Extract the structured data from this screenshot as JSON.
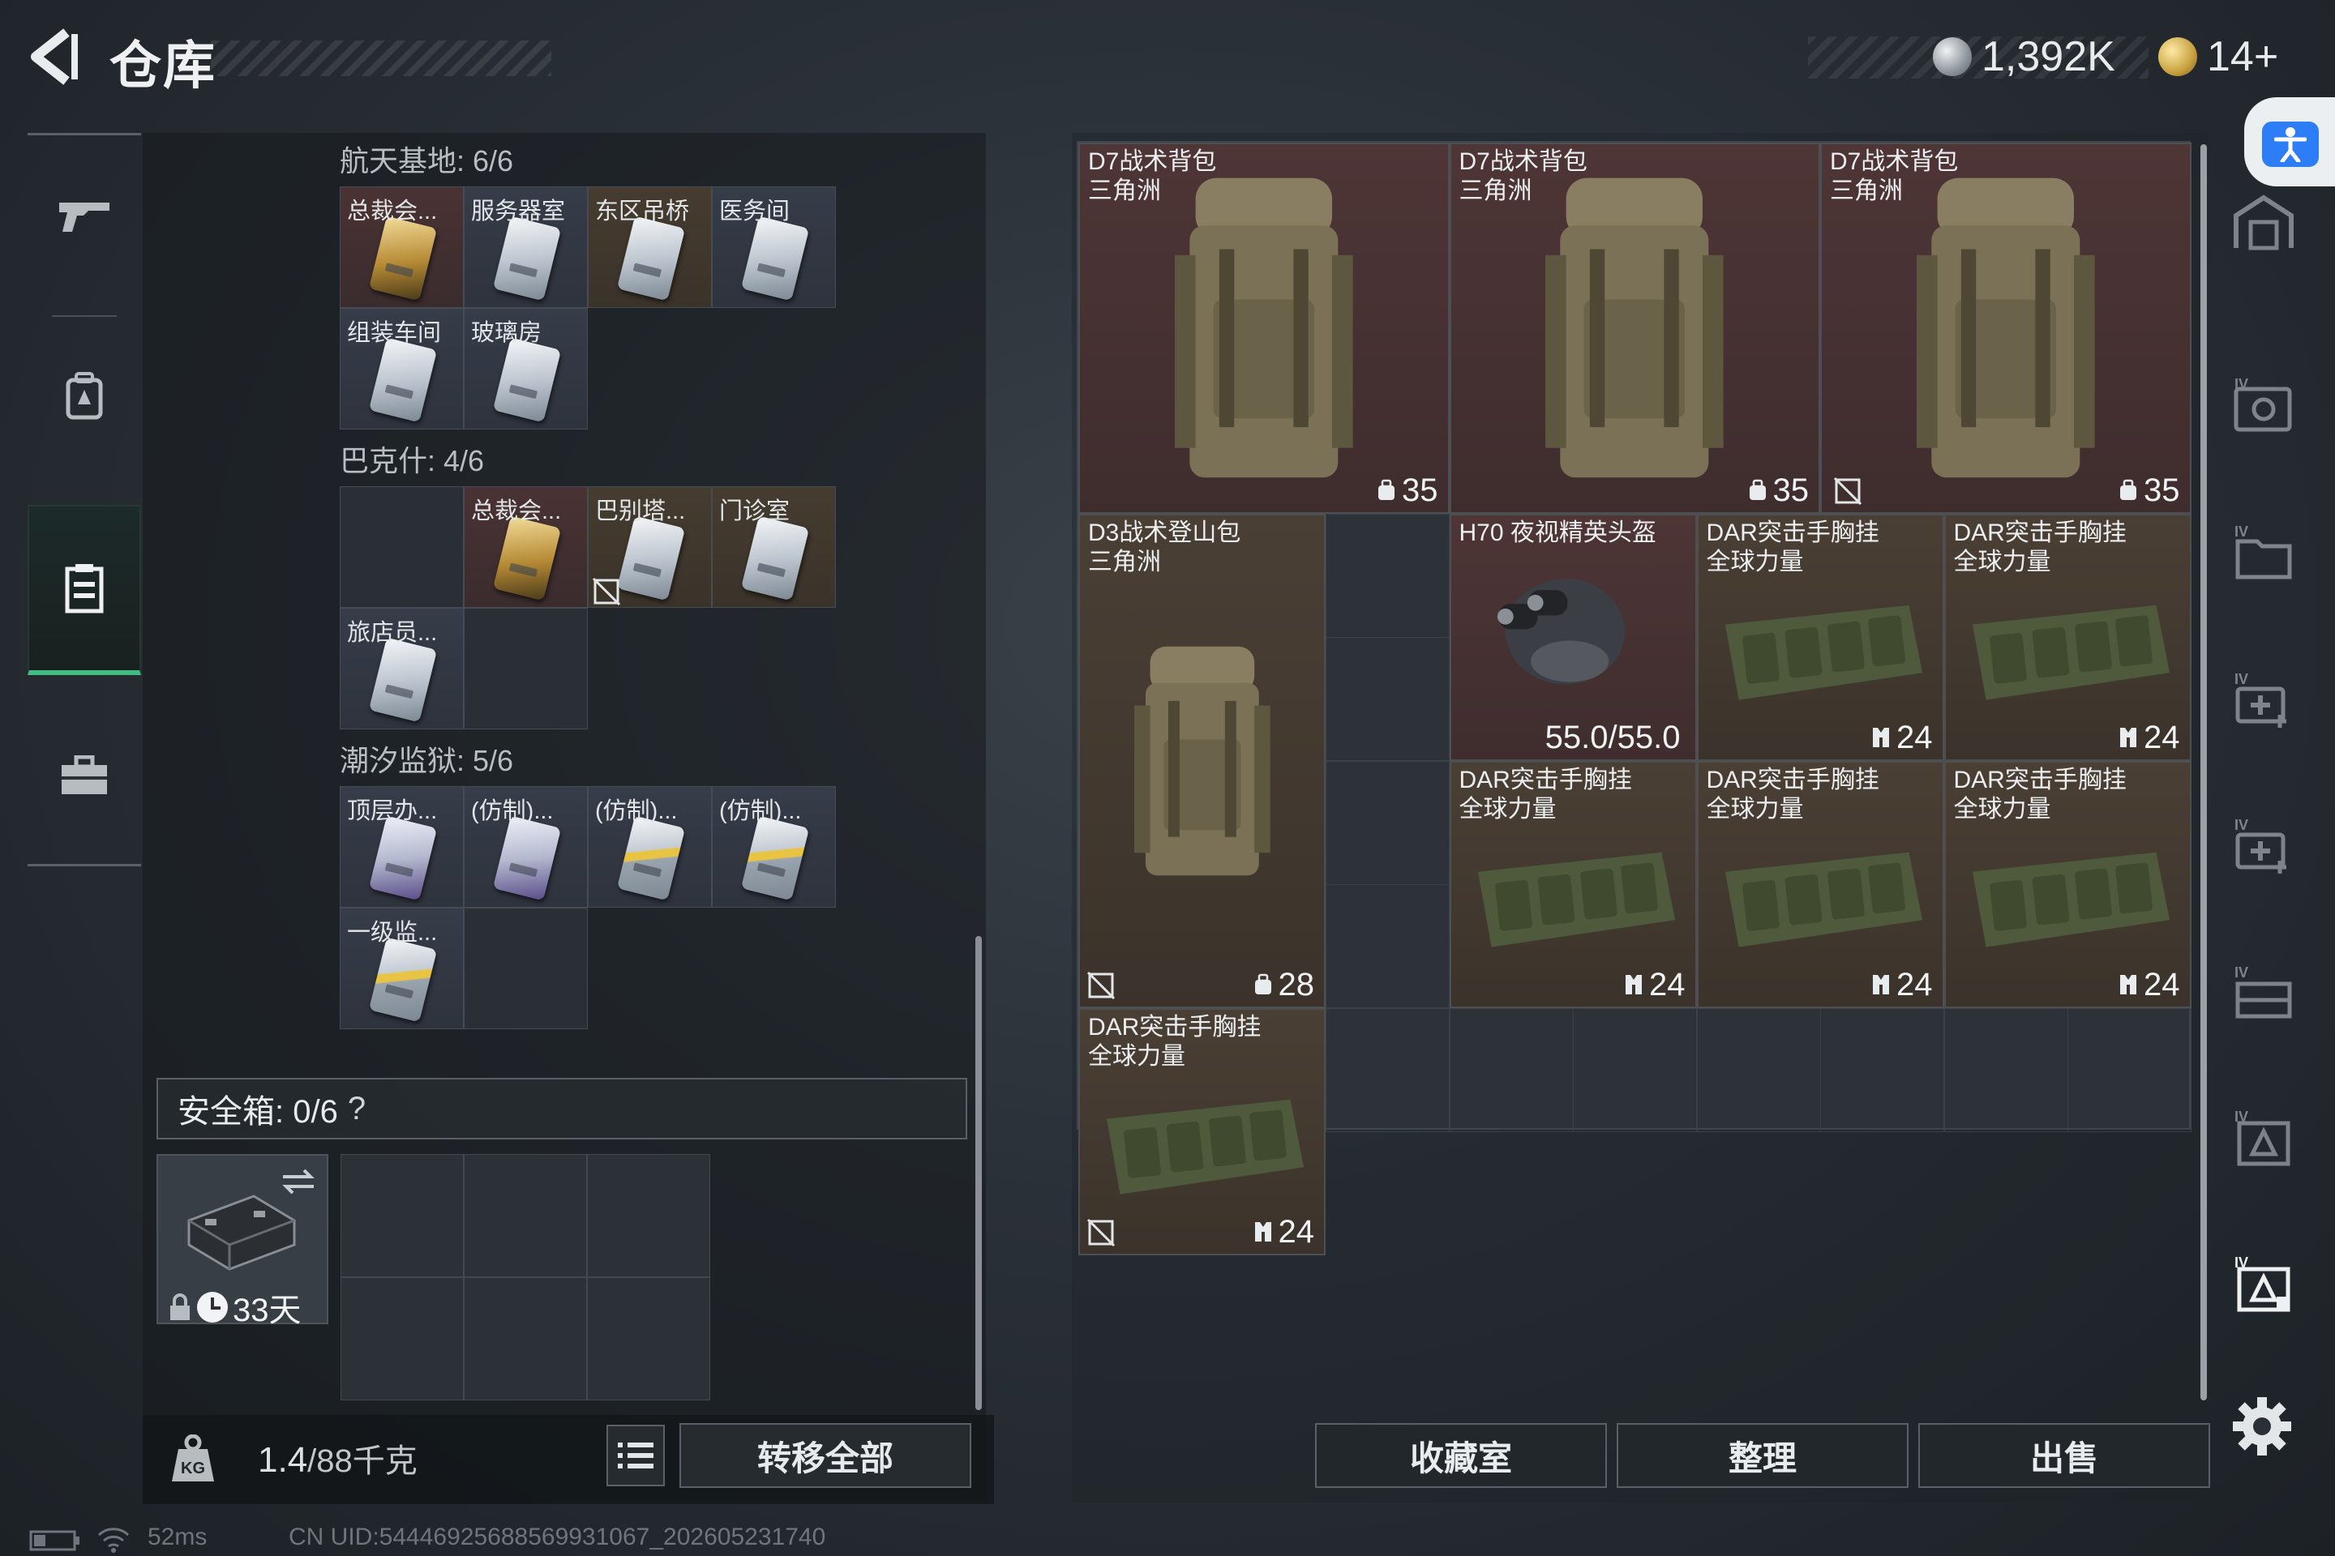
{
  "header": {
    "title": "仓库",
    "currency_silver": "1,392K",
    "currency_gold": "14+"
  },
  "left_panel": {
    "groups": [
      {
        "label": "航天基地: 6/6",
        "cells": [
          {
            "label": "总裁会...",
            "bg": "red",
            "card": "gold"
          },
          {
            "label": "服务器室",
            "bg": "blue",
            "card": "white"
          },
          {
            "label": "东区吊桥",
            "bg": "tan",
            "card": "white"
          },
          {
            "label": "医务间",
            "bg": "blue",
            "card": "white"
          },
          {
            "label": "组装车间",
            "bg": "blue",
            "card": "white"
          },
          {
            "label": "玻璃房",
            "bg": "blue",
            "card": "white"
          }
        ]
      },
      {
        "label": "巴克什: 4/6",
        "cells": [
          {
            "label": "",
            "bg": "dark",
            "card": ""
          },
          {
            "label": "总裁会...",
            "bg": "red",
            "card": "gold"
          },
          {
            "label": "巴别塔...",
            "bg": "tan",
            "card": "white"
          },
          {
            "label": "门诊室",
            "bg": "tan",
            "card": "white"
          },
          {
            "label": "旅店员...",
            "bg": "blue",
            "card": "white"
          },
          {
            "label": "",
            "bg": "dark",
            "card": ""
          }
        ]
      },
      {
        "label": "潮汐监狱: 5/6",
        "cells": [
          {
            "label": "顶层办...",
            "bg": "blue",
            "card": "purple"
          },
          {
            "label": "(仿制)...",
            "bg": "blue",
            "card": "purple"
          },
          {
            "label": "(仿制)...",
            "bg": "blue",
            "card": "stripe"
          },
          {
            "label": "(仿制)...",
            "bg": "blue",
            "card": "stripe"
          },
          {
            "label": "一级监...",
            "bg": "blue",
            "card": "stripe"
          },
          {
            "label": "",
            "bg": "dark",
            "card": ""
          }
        ]
      }
    ],
    "safe_box_label": "安全箱: 0/6",
    "safe_box_help": "?",
    "safe_item_timer": "33天",
    "weight_value": "1.4",
    "weight_max": "/88千克",
    "transfer_all_label": "转移全部"
  },
  "stash": {
    "items": [
      {
        "name": "D7战术背包\n三角洲",
        "count": "35",
        "count_icon": "weight-icon",
        "bg": "red",
        "kind": "backpack"
      },
      {
        "name": "D7战术背包\n三角洲",
        "count": "35",
        "count_icon": "weight-icon",
        "bg": "red",
        "kind": "backpack"
      },
      {
        "name": "D7战术背包\n三角洲",
        "count": "35",
        "count_icon": "weight-icon",
        "bg": "red",
        "kind": "backpack"
      },
      {
        "name": "D3战术登山包\n三角洲",
        "count": "28",
        "count_icon": "weight-icon",
        "bg": "tan",
        "kind": "backpack"
      },
      {
        "name": "H70 夜视精英头盔",
        "durability": "55.0/55.0",
        "bg": "red",
        "kind": "helmet"
      },
      {
        "name": "DAR突击手胸挂\n全球力量",
        "count": "24",
        "count_icon": "vest-icon",
        "bg": "tan",
        "kind": "vest"
      },
      {
        "name": "DAR突击手胸挂\n全球力量",
        "count": "24",
        "count_icon": "vest-icon",
        "bg": "tan",
        "kind": "vest"
      },
      {
        "name": "DAR突击手胸挂\n全球力量",
        "count": "24",
        "count_icon": "vest-icon",
        "bg": "tan",
        "kind": "vest"
      },
      {
        "name": "DAR突击手胸挂\n全球力量",
        "count": "24",
        "count_icon": "vest-icon",
        "bg": "tan",
        "kind": "vest"
      },
      {
        "name": "DAR突击手胸挂\n全球力量",
        "count": "24",
        "count_icon": "vest-icon",
        "bg": "tan",
        "kind": "vest"
      },
      {
        "name": "DAR突击手胸挂\n全球力量",
        "count": "24",
        "count_icon": "vest-icon",
        "bg": "tan",
        "kind": "vest"
      }
    ]
  },
  "bottom_actions": {
    "collection": "收藏室",
    "organize": "整理",
    "sell": "出售"
  },
  "status_bar": {
    "ping": "52ms",
    "uid": "CN UID:5444692568856993106​7_202605231740"
  },
  "colors": {
    "accent_green": "#3fbf7f",
    "red_rarity": "#4e3536",
    "tan_rarity": "#4a3f35",
    "access_blue": "#2d7df6"
  }
}
